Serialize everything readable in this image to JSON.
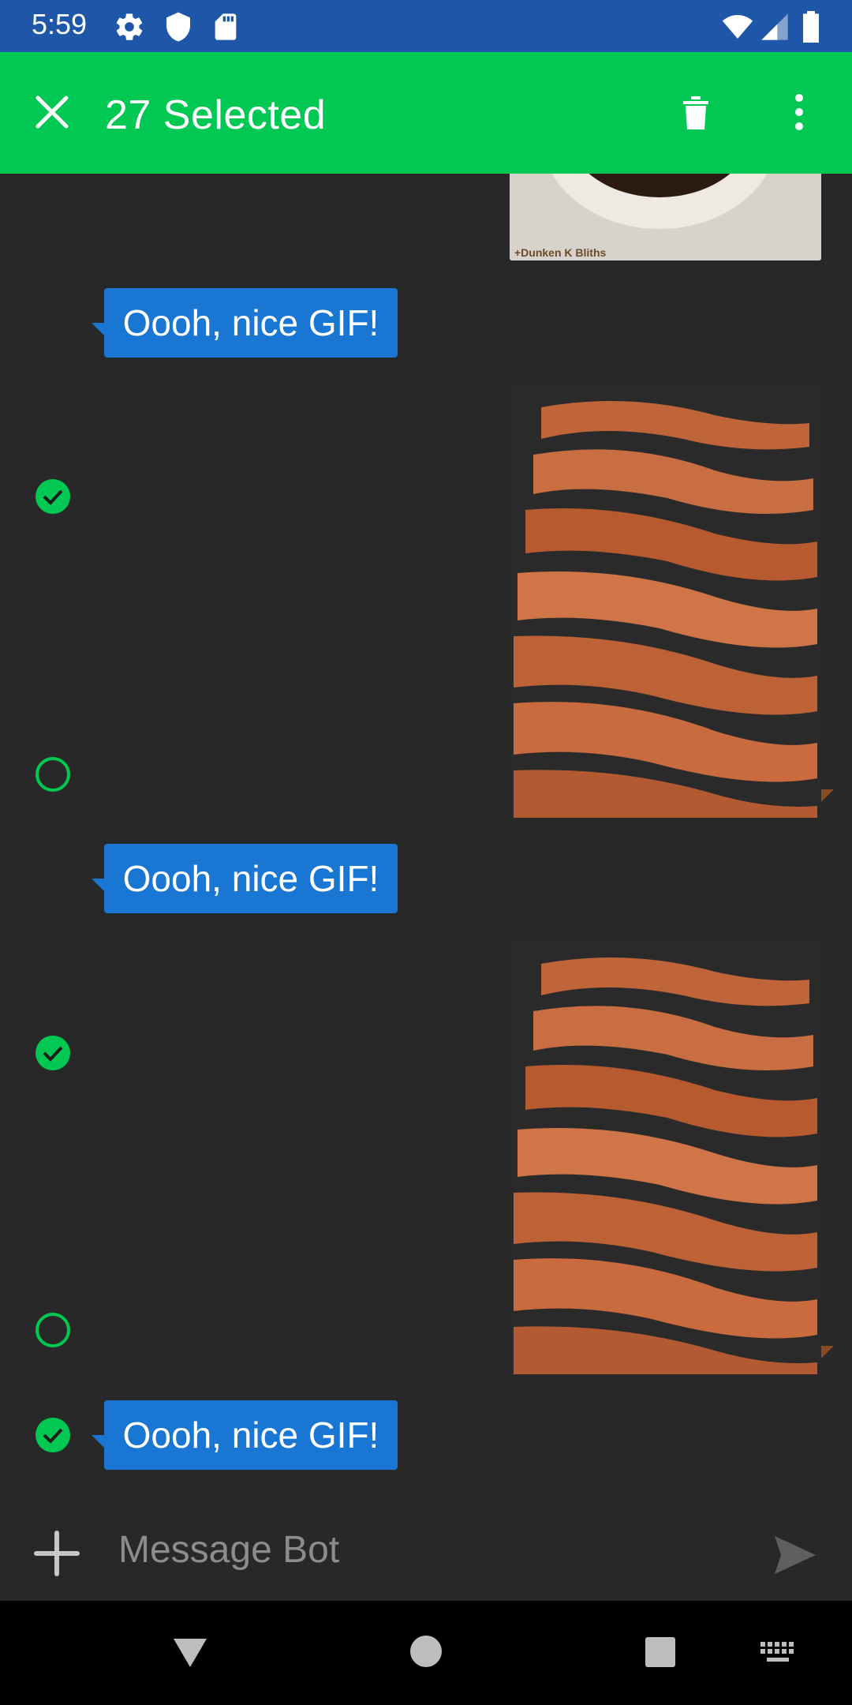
{
  "status_bar": {
    "time": "5:59",
    "icons_left": [
      "gear-icon",
      "shield-icon",
      "sd-card-icon"
    ],
    "icons_right": [
      "wifi-icon",
      "signal-icon",
      "battery-icon"
    ]
  },
  "app_bar": {
    "title": "27 Selected",
    "close_icon": "close-icon",
    "delete_icon": "trash-icon",
    "more_icon": "more-vert-icon",
    "color": "#00c853"
  },
  "messages": [
    {
      "type": "gif",
      "caption": "+Dunken K Bliths",
      "selected": false
    },
    {
      "type": "text",
      "text": "Oooh, nice GIF!",
      "selected": true
    },
    {
      "type": "gif",
      "selected": false
    },
    {
      "type": "text",
      "text": "Oooh, nice GIF!",
      "selected": true
    },
    {
      "type": "gif",
      "selected": false
    },
    {
      "type": "text",
      "text": "Oooh, nice GIF!",
      "selected": true
    }
  ],
  "composer": {
    "placeholder": "Message Bot",
    "add_icon": "plus-icon",
    "send_icon": "send-icon"
  },
  "nav_bar": {
    "icons": [
      "back-icon",
      "home-icon",
      "recents-icon",
      "keyboard-icon"
    ]
  },
  "colors": {
    "status_bar": "#1e56a8",
    "bubble": "#1976d2",
    "background": "#282828",
    "select_accent": "#00c853"
  }
}
